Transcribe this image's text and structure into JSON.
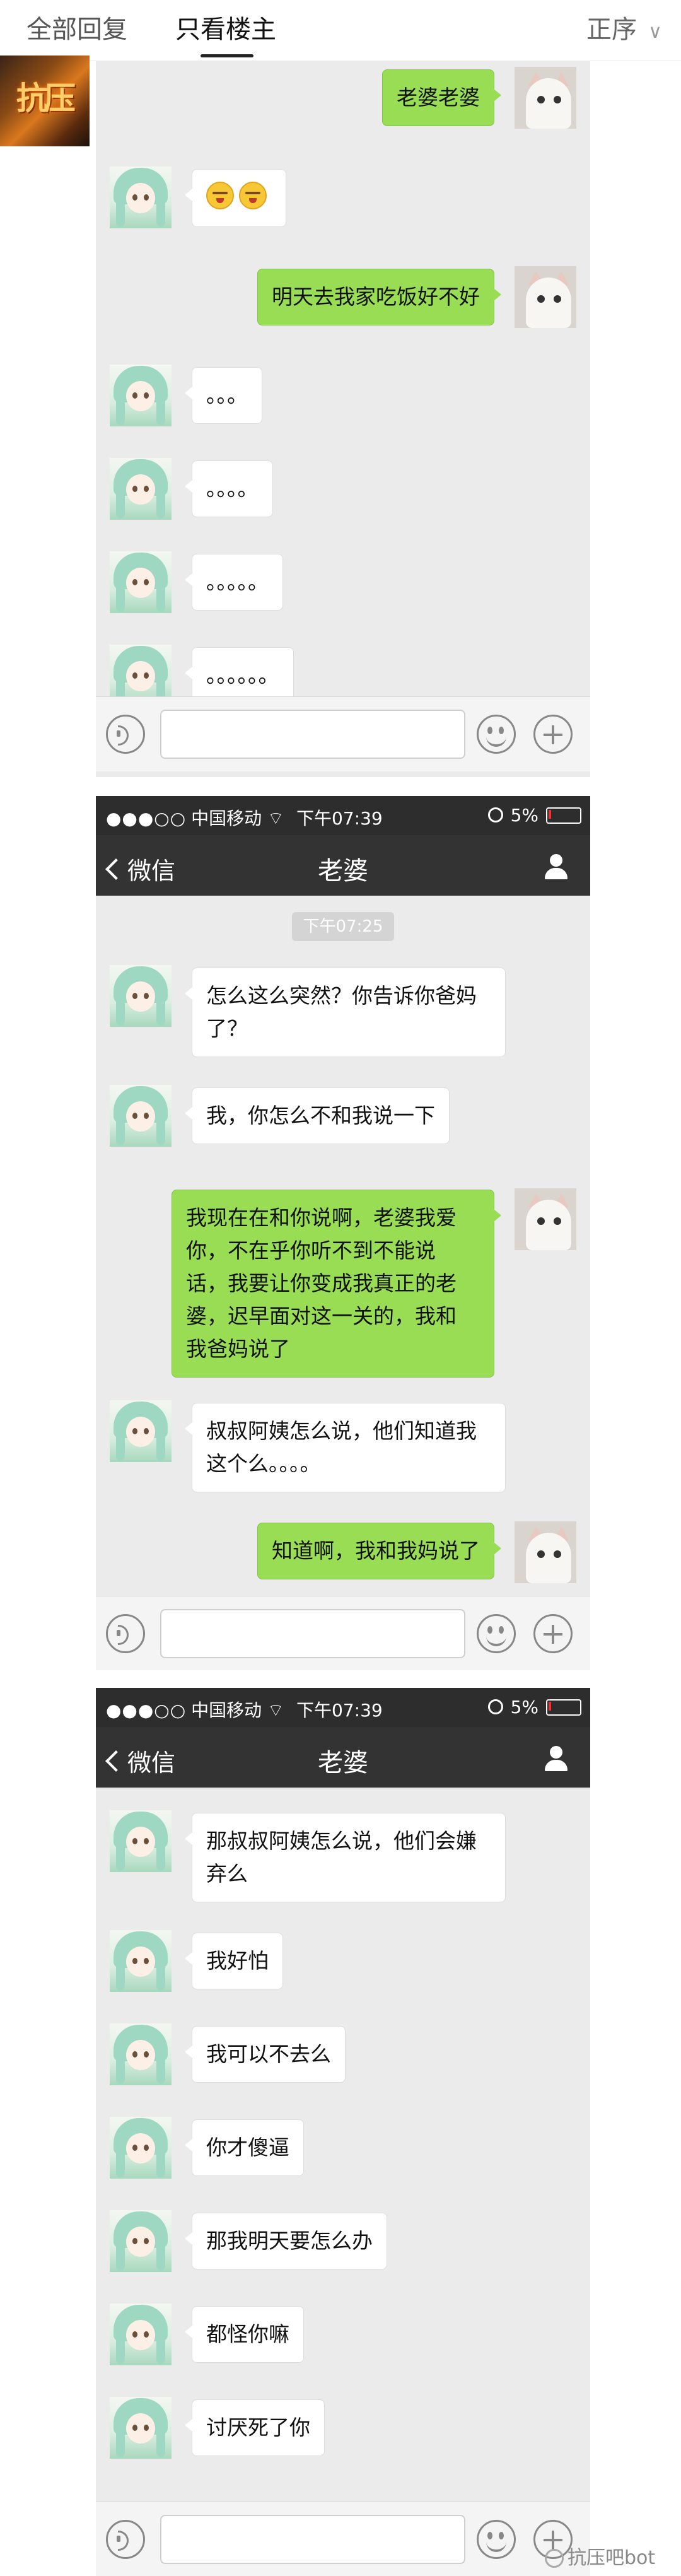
{
  "tieba_header": {
    "tabs": [
      {
        "label": "全部回复"
      },
      {
        "label": "只看楼主"
      }
    ],
    "sort_label": "正序"
  },
  "screenshot1": {
    "messages": [
      {
        "side": "right",
        "text": "老婆老婆"
      },
      {
        "side": "left",
        "text": ""
      },
      {
        "side": "right",
        "text": "明天去我家吃饭好不好"
      },
      {
        "side": "left",
        "text": "。。。"
      },
      {
        "side": "left",
        "text": "。。。。"
      },
      {
        "side": "left",
        "text": "。。。。。"
      },
      {
        "side": "left",
        "text": "。。。。。。"
      }
    ]
  },
  "screenshot2": {
    "status": {
      "carrier": "中国移动",
      "time": "下午07:39",
      "battery": "5%"
    },
    "nav": {
      "back_label": "微信",
      "title": "老婆"
    },
    "timestamp": "下午07:25",
    "messages": [
      {
        "side": "left",
        "lines": [
          "怎么这么突然？你告诉你爸妈",
          "了？"
        ]
      },
      {
        "side": "left",
        "lines": [
          "我，你怎么不和我说一下"
        ]
      },
      {
        "side": "right",
        "lines": [
          "我现在在和你说啊，老婆我爱",
          "你，不在乎你听不到不能说",
          "话，我要让你变成我真正的老",
          "婆，迟早面对这一关的，我和",
          "我爸妈说了"
        ]
      },
      {
        "side": "left",
        "lines": [
          "叔叔阿姨怎么说，他们知道我",
          "这个么。。。。"
        ]
      },
      {
        "side": "right",
        "lines": [
          "知道啊，我和我妈说了"
        ]
      }
    ]
  },
  "screenshot3": {
    "status": {
      "carrier": "中国移动",
      "time": "下午07:39",
      "battery": "5%"
    },
    "nav": {
      "back_label": "微信",
      "title": "老婆"
    },
    "messages": [
      {
        "side": "left",
        "lines": [
          "那叔叔阿姨怎么说，他们会嫌",
          "弃么"
        ]
      },
      {
        "side": "left",
        "lines": [
          "我好怕"
        ]
      },
      {
        "side": "left",
        "lines": [
          "我可以不去么"
        ]
      },
      {
        "side": "left",
        "lines": [
          "你才傻逼"
        ]
      },
      {
        "side": "left",
        "lines": [
          "那我明天要怎么办"
        ]
      },
      {
        "side": "left",
        "lines": [
          "都怪你嘛"
        ]
      },
      {
        "side": "left",
        "lines": [
          "讨厌死了你"
        ]
      }
    ]
  },
  "watermark": "抗压吧bot",
  "colors": {
    "chat_bg": "#ebebeb",
    "right_bubble": "#99dd55",
    "left_bubble": "#ffffff",
    "navbar": "#333333",
    "statusbar": "#2d2d2d"
  },
  "icons": [
    "chevron-down-icon",
    "back-chevron-icon",
    "person-icon",
    "voice-icon",
    "emoji-icon",
    "plus-icon",
    "lock-icon",
    "battery-icon",
    "wifi-icon"
  ]
}
